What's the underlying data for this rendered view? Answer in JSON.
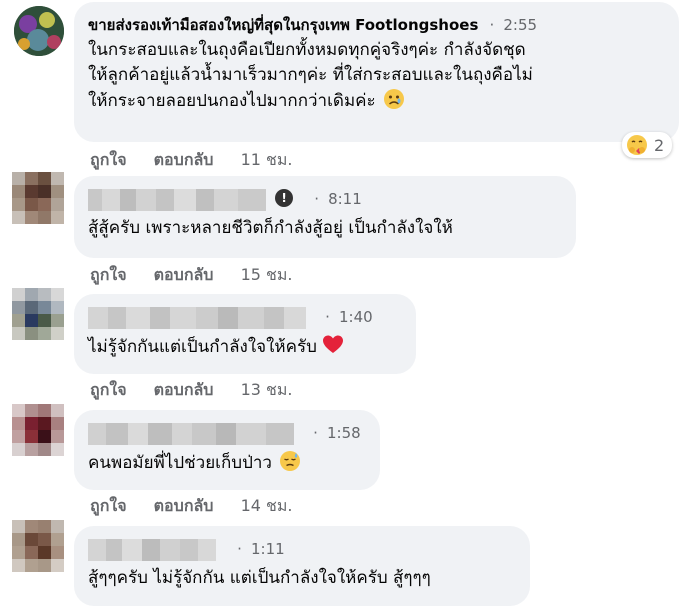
{
  "comments": [
    {
      "author": "ขายส่งรองเท้ามือสองใหญ่ที่สุดในกรุงเทพ Footlongshoes",
      "time": "2:55",
      "lines": [
        "ในกระสอบและในถุงคือเปียกทั้งหมดทุกคู่จริงๆค่ะ กำลังจัดชุด",
        "ให้ลูกค้าอยู่แล้วน้ำมาเร็วมากๆค่ะ ที่ใส่กระสอบและในถุงคือไม่",
        "ให้กระจายลอยปนกองไปมากกว่าเดิมค่ะ"
      ],
      "emoji": "sad-face-emoji",
      "reaction_count": "2",
      "like_label": "ถูกใจ",
      "reply_label": "ตอบกลับ",
      "ago": "11 ชม."
    },
    {
      "time": "8:11",
      "lines": [
        "สู้สู้ครับ เพราะหลายชีวิตก็กำลังสู้อยู่ เป็นกำลังใจให้"
      ],
      "like_label": "ถูกใจ",
      "reply_label": "ตอบกลับ",
      "ago": "15 ชม."
    },
    {
      "time": "1:40",
      "lines": [
        "ไม่รู้จักกันแต่เป็นกำลังใจให้ครับ"
      ],
      "emoji": "red-heart-emoji",
      "like_label": "ถูกใจ",
      "reply_label": "ตอบกลับ",
      "ago": "13 ชม."
    },
    {
      "time": "1:58",
      "lines": [
        "คนพอมัยพี่ไปช่วยเก็บป่าว"
      ],
      "emoji": "sweat-face-emoji",
      "like_label": "ถูกใจ",
      "reply_label": "ตอบกลับ",
      "ago": "14 ชม."
    },
    {
      "time": "1:11",
      "lines": [
        "สู้ๆๆครับ ไม่รู้จักกัน แต่เป็นกำลังใจให้ครับ สู้ๆๆๆ"
      ]
    }
  ],
  "separator": "·",
  "colors": {
    "bubble": "#f0f2f5",
    "text": "#050505",
    "secondary": "#65676b"
  }
}
